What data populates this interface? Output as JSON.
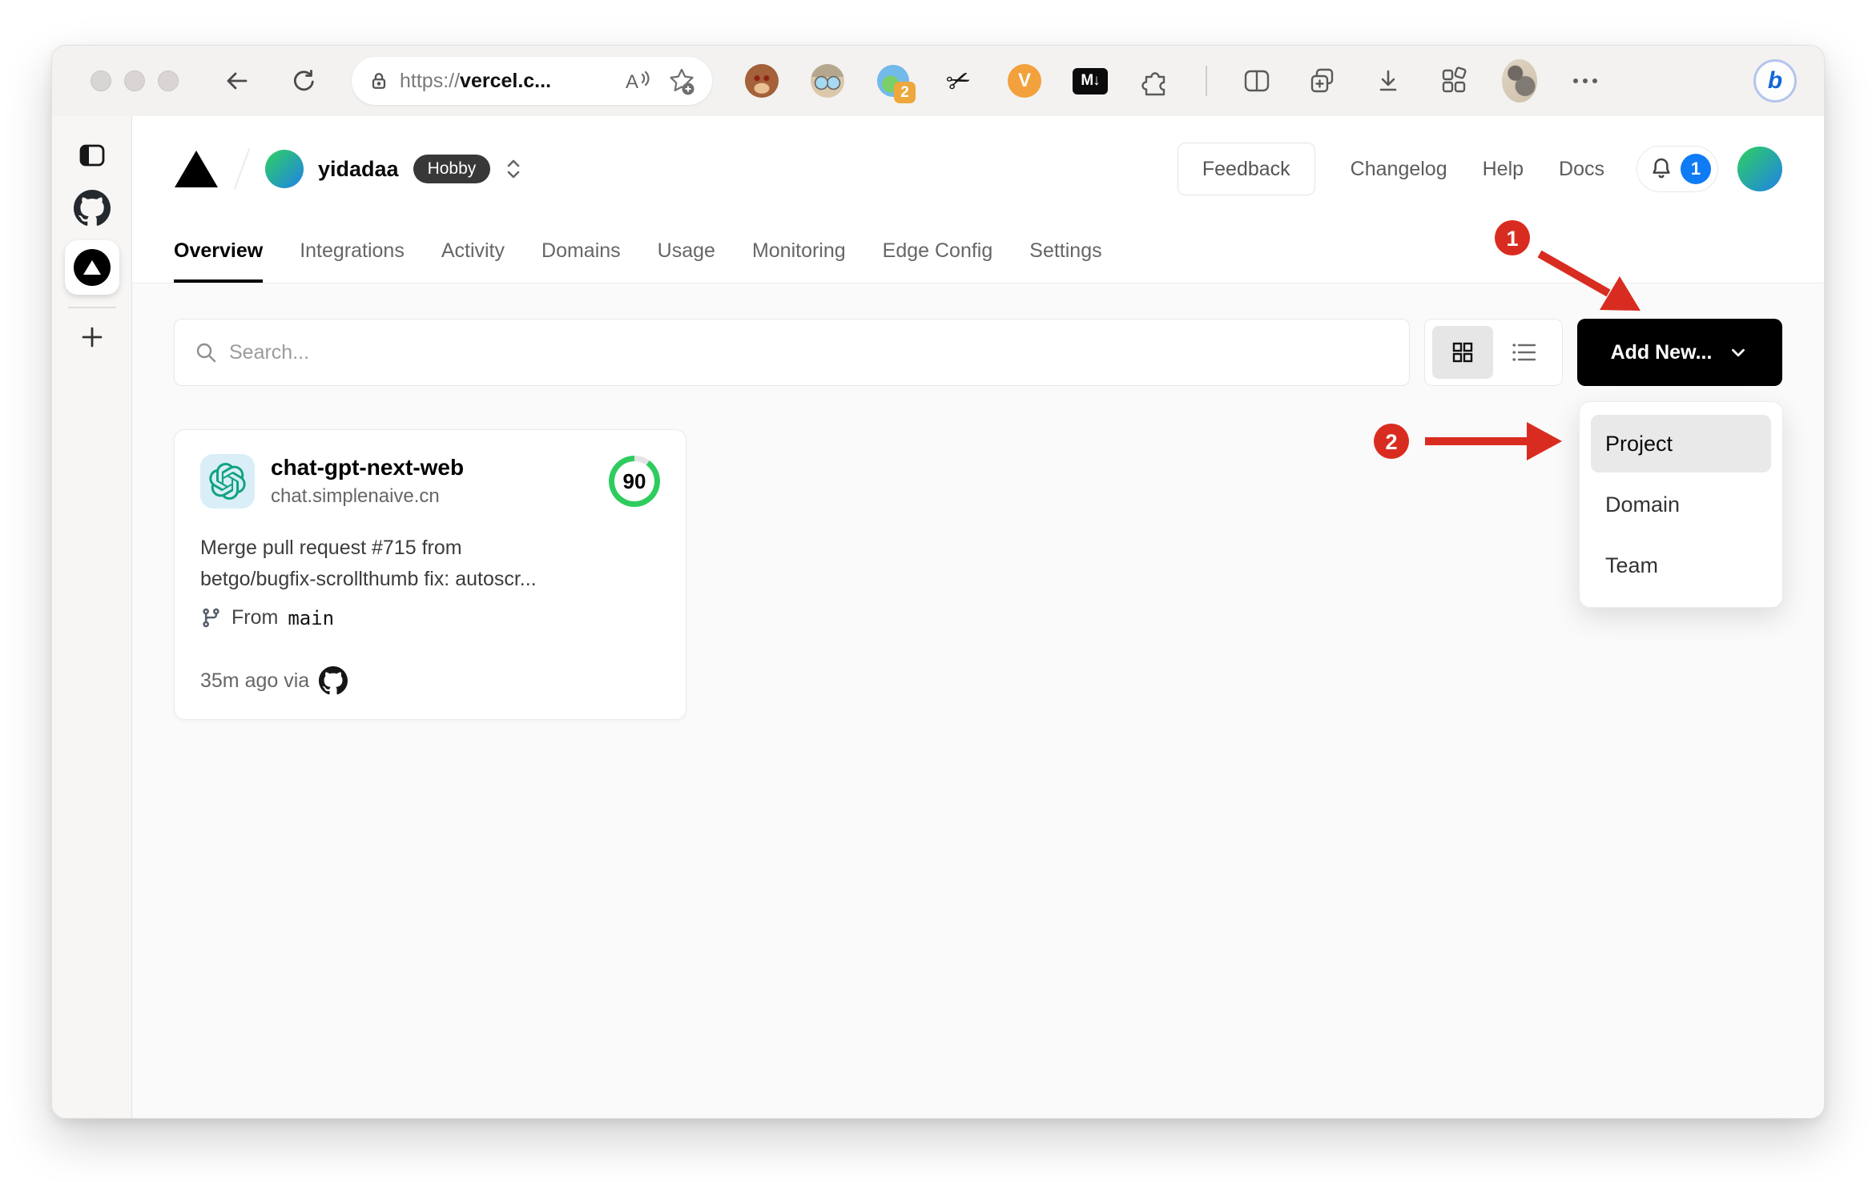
{
  "browser": {
    "url": {
      "scheme": "https://",
      "host": "vercel.c..."
    },
    "extensions": {
      "tab_count_badge": "2",
      "scissors_glyph": "✂",
      "video_label": "V",
      "markdown_label": "M↓",
      "bing_label": "b"
    }
  },
  "vercel": {
    "team": {
      "name": "yidadaa",
      "plan": "Hobby"
    },
    "header": {
      "feedback": "Feedback",
      "changelog": "Changelog",
      "help": "Help",
      "docs": "Docs",
      "notification_count": "1"
    },
    "tabs": [
      {
        "label": "Overview",
        "active": true
      },
      {
        "label": "Integrations"
      },
      {
        "label": "Activity"
      },
      {
        "label": "Domains"
      },
      {
        "label": "Usage"
      },
      {
        "label": "Monitoring"
      },
      {
        "label": "Edge Config"
      },
      {
        "label": "Settings"
      }
    ],
    "controls": {
      "search_placeholder": "Search...",
      "add_new": "Add New..."
    },
    "menu": {
      "items": [
        {
          "label": "Project",
          "highlighted": true
        },
        {
          "label": "Domain"
        },
        {
          "label": "Team"
        }
      ]
    },
    "card": {
      "name": "chat-gpt-next-web",
      "domain": "chat.simplenaive.cn",
      "score": "90",
      "commit_lines": [
        "Merge pull request #715 from",
        "betgo/bugfix-scrollthumb fix: autoscr..."
      ],
      "branch_label": "From",
      "branch": "main",
      "meta": "35m ago via"
    }
  },
  "annotations": {
    "step1": "1",
    "step2": "2"
  },
  "colors": {
    "annotation_red": "#d92c20",
    "score_green": "#2ecc5f",
    "notification_blue": "#0f7bf4",
    "add_new_bg": "#000000"
  }
}
